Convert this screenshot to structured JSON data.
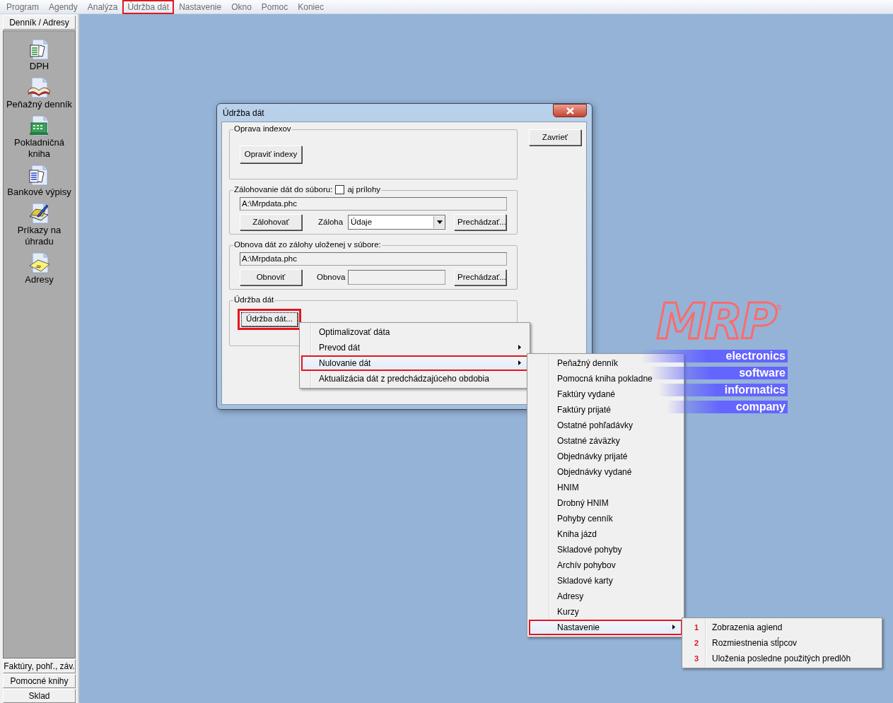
{
  "menubar": [
    {
      "label": "Program",
      "annotated": false
    },
    {
      "label": "Agendy",
      "annotated": false
    },
    {
      "label": "Analýza",
      "annotated": false
    },
    {
      "label": "Údržba dát",
      "annotated": true
    },
    {
      "label": "Nastavenie",
      "annotated": false
    },
    {
      "label": "Okno",
      "annotated": false
    },
    {
      "label": "Pomoc",
      "annotated": false
    },
    {
      "label": "Koniec",
      "annotated": false
    }
  ],
  "sidebar": {
    "top_tab": "Denník / Adresy",
    "items": [
      {
        "label": "DPH",
        "kind": "sheets"
      },
      {
        "label": "Peňažný denník",
        "kind": "book"
      },
      {
        "label": "Pokladničná kniha",
        "kind": "register"
      },
      {
        "label": "Bankové výpisy",
        "kind": "pages"
      },
      {
        "label": "Príkazy na úhradu",
        "kind": "signing"
      },
      {
        "label": "Adresy",
        "kind": "envelope"
      }
    ],
    "bottom_tabs": [
      "Faktúry, pohľ., záv.",
      "Pomocné knihy",
      "Sklad"
    ]
  },
  "dialog": {
    "title": "Údržba dát",
    "close_button": "Zavrieť",
    "index_group": {
      "title": "Oprava indexov",
      "button": "Opraviť indexy"
    },
    "backup_group": {
      "title": "Zálohovanie dát do súboru:",
      "checkbox": {
        "label": "aj prílohy",
        "checked": false
      },
      "path": "A:\\Mrpdata.phc",
      "button": "Zálohovať",
      "select_label": "Záloha",
      "select_value": "Údaje",
      "browse": "Prechádzať..."
    },
    "restore_group": {
      "title": "Obnova dát zo zálohy uloženej v súbore:",
      "path": "A:\\Mrpdata.phc",
      "button": "Obnoviť",
      "field_label": "Obnova",
      "browse": "Prechádzať..."
    },
    "maintenance_group": {
      "title": "Údržba dát",
      "button": {
        "label": "Údržba dát...",
        "annotated": true
      }
    }
  },
  "menus": [
    {
      "items": [
        {
          "label": "Optimalizovať dáta",
          "selected": false,
          "submenu": false,
          "annotated": false
        },
        {
          "label": "Prevod dát",
          "selected": false,
          "submenu": true,
          "annotated": false
        },
        {
          "label": "Nulovanie dát",
          "selected": true,
          "submenu": true,
          "annotated": true
        },
        {
          "label": "Aktualizácia dát z predchádzajúceho obdobia",
          "selected": false,
          "submenu": false,
          "annotated": false
        }
      ]
    },
    {
      "items": [
        {
          "label": "Peňažný denník",
          "selected": false,
          "submenu": false,
          "annotated": false
        },
        {
          "label": "Pomocná kniha pokladne",
          "selected": false,
          "submenu": false,
          "annotated": false
        },
        {
          "label": "Faktúry vydané",
          "selected": false,
          "submenu": false,
          "annotated": false
        },
        {
          "label": "Faktúry prijaté",
          "selected": false,
          "submenu": false,
          "annotated": false
        },
        {
          "label": "Ostatné pohľadávky",
          "selected": false,
          "submenu": false,
          "annotated": false
        },
        {
          "label": "Ostatné záväzky",
          "selected": false,
          "submenu": false,
          "annotated": false
        },
        {
          "label": "Objednávky prijaté",
          "selected": false,
          "submenu": false,
          "annotated": false
        },
        {
          "label": "Objednávky vydané",
          "selected": false,
          "submenu": false,
          "annotated": false
        },
        {
          "label": "HNIM",
          "selected": false,
          "submenu": false,
          "annotated": false
        },
        {
          "label": "Drobný HNIM",
          "selected": false,
          "submenu": false,
          "annotated": false
        },
        {
          "label": "Pohyby cenník",
          "selected": false,
          "submenu": false,
          "annotated": false
        },
        {
          "label": "Kniha jázd",
          "selected": false,
          "submenu": false,
          "annotated": false
        },
        {
          "label": "Skladové pohyby",
          "selected": false,
          "submenu": false,
          "annotated": false
        },
        {
          "label": "Archív pohybov",
          "selected": false,
          "submenu": false,
          "annotated": false
        },
        {
          "label": "Skladové karty",
          "selected": false,
          "submenu": false,
          "annotated": false
        },
        {
          "label": "Adresy",
          "selected": false,
          "submenu": false,
          "annotated": false
        },
        {
          "label": "Kurzy",
          "selected": false,
          "submenu": false,
          "annotated": false
        },
        {
          "label": "Nastavenie",
          "selected": true,
          "submenu": true,
          "annotated": true
        }
      ]
    },
    {
      "items": [
        {
          "number": "1",
          "label": "Zobrazenia agiend",
          "selected": false,
          "submenu": false,
          "annotated": false
        },
        {
          "number": "2",
          "label": "Rozmiestnenia stĺpcov",
          "selected": false,
          "submenu": false,
          "annotated": false
        },
        {
          "number": "3",
          "label": "Uloženia posledne použitých predlôh",
          "selected": false,
          "submenu": false,
          "annotated": false
        }
      ]
    }
  ],
  "logo": {
    "wordmark": "MRP",
    "registered": "®",
    "taglines": [
      "electronics",
      "software",
      "informatics",
      "company"
    ]
  }
}
